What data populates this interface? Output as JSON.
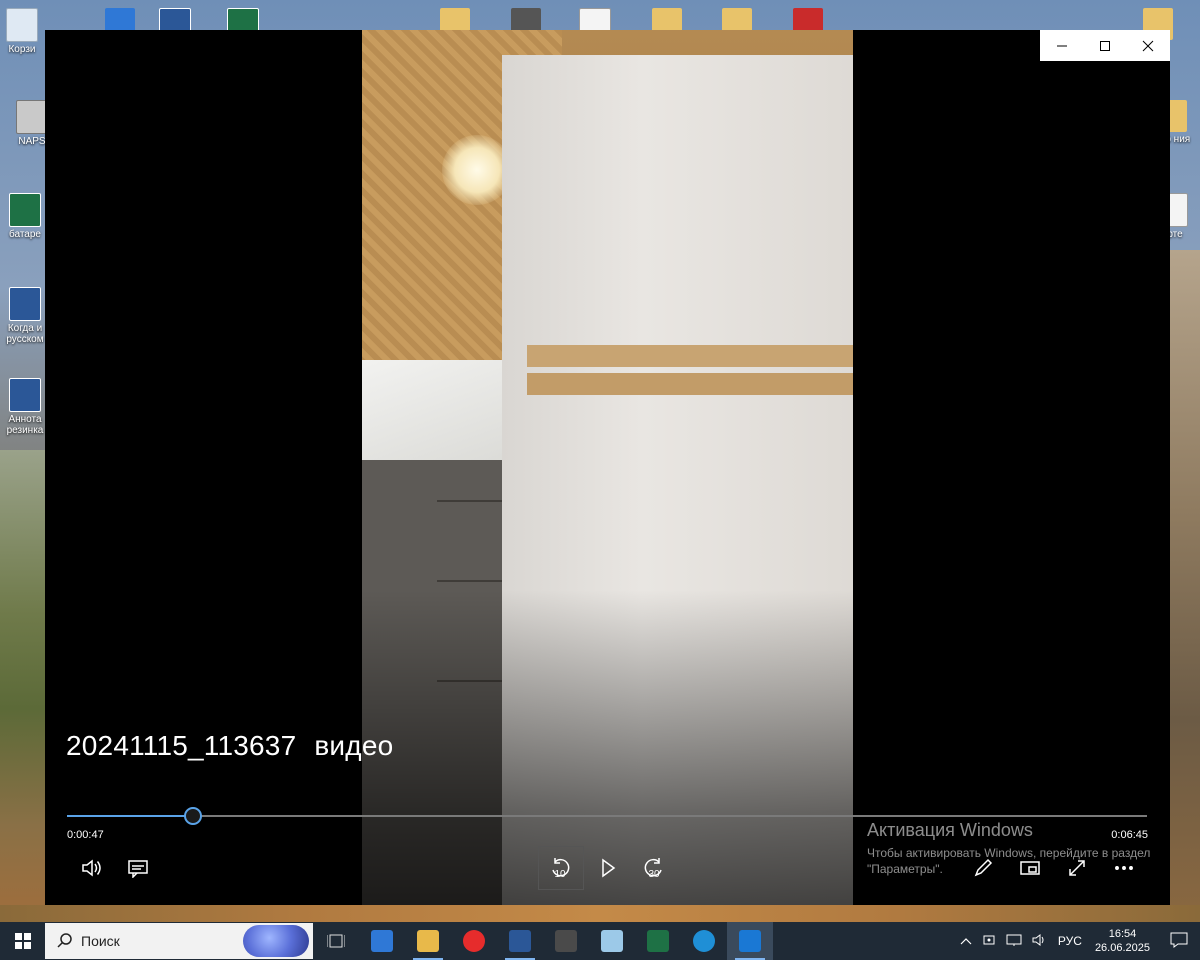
{
  "desktop": {
    "icons_left": [
      {
        "label": "Корзи",
        "icon": "recycle-bin-icon"
      },
      {
        "label": "NAPS",
        "icon": "scanner-icon"
      },
      {
        "label": "батаре",
        "icon": "excel-icon"
      },
      {
        "label": "Когда и русском",
        "icon": "word-icon"
      },
      {
        "label": "Аннота резинка",
        "icon": "word-icon"
      }
    ],
    "icons_right": [
      {
        "label": "ор ния",
        "icon": "folder-icon"
      },
      {
        "label": "рте",
        "icon": "document-icon"
      }
    ]
  },
  "player": {
    "window_controls": {
      "minimize": "—",
      "maximize": "☐",
      "close": "✕"
    },
    "title": {
      "name": "20241115_113637",
      "type": "видео"
    },
    "progress": {
      "current": "0:00:47",
      "total": "0:06:45",
      "fraction": 0.116
    },
    "skip_back": "10",
    "skip_forward": "30"
  },
  "activation": {
    "title": "Активация Windows",
    "subtitle": "Чтобы активировать Windows, перейдите в раздел \"Параметры\"."
  },
  "taskbar": {
    "search_label": "Поиск",
    "apps": [
      {
        "name": "task-view",
        "color": "#d0d0d0"
      },
      {
        "name": "store",
        "color": "#2f78d6"
      },
      {
        "name": "explorer",
        "color": "#e8b94a"
      },
      {
        "name": "yandex",
        "color": "#e62c2c"
      },
      {
        "name": "word",
        "color": "#2b5797"
      },
      {
        "name": "calculator",
        "color": "#4a4a4a"
      },
      {
        "name": "paint",
        "color": "#9cc9e8"
      },
      {
        "name": "excel",
        "color": "#1e7145"
      },
      {
        "name": "edge",
        "color": "#1f8fd6"
      },
      {
        "name": "movies-tv",
        "color": "#1a78d4"
      }
    ],
    "tray": {
      "language": "РУС",
      "time": "16:54",
      "date": "26.06.2025"
    }
  }
}
